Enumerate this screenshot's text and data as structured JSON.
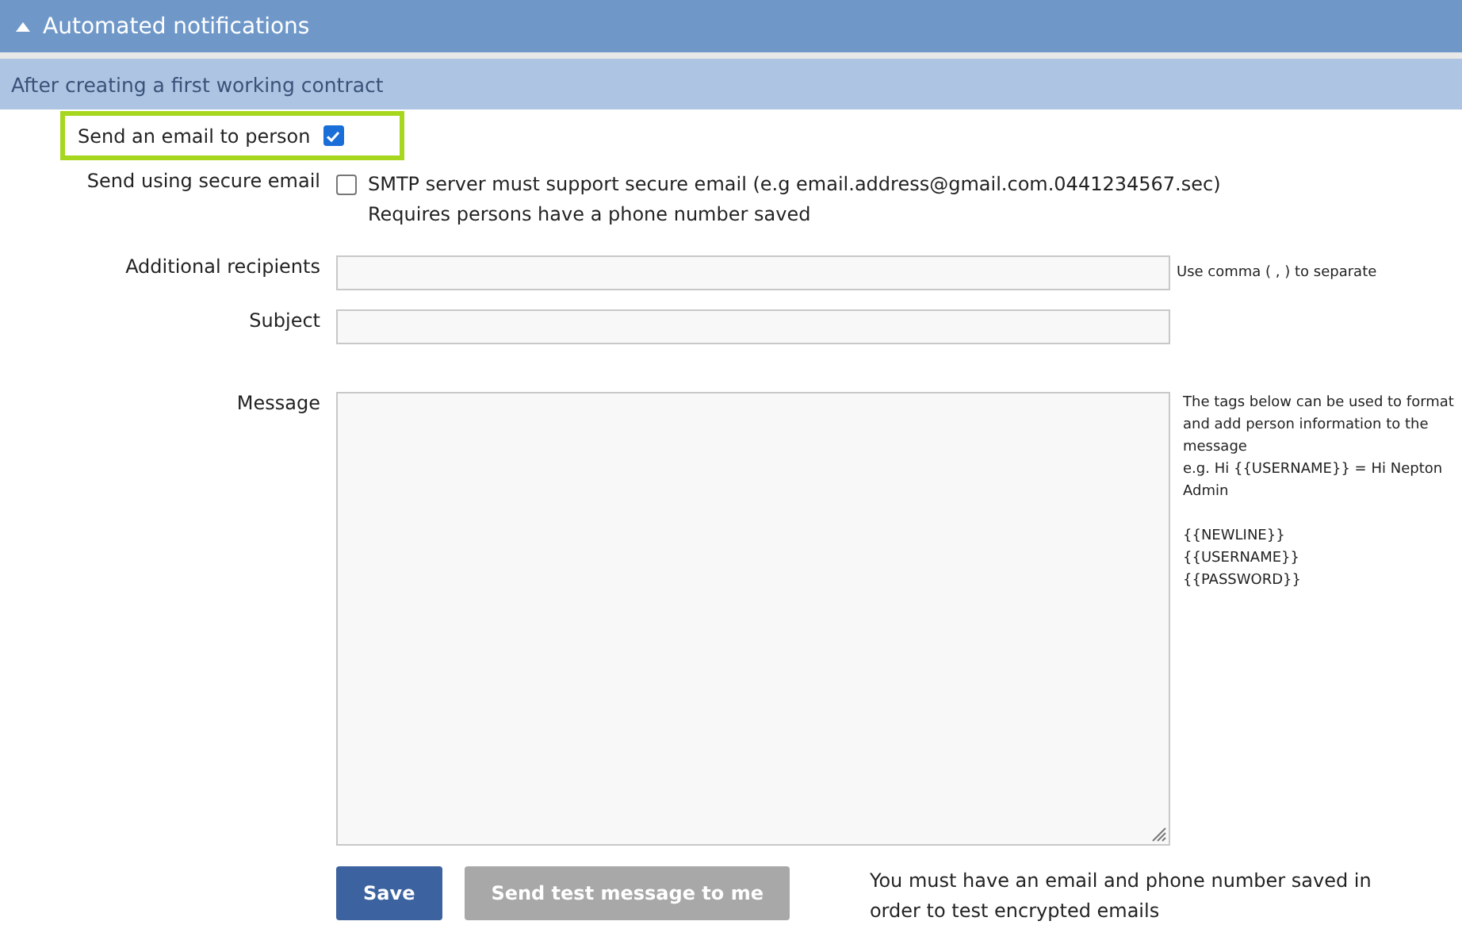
{
  "section": {
    "title": "Automated notifications",
    "expanded": true
  },
  "subsection": {
    "title": "After creating a first working contract"
  },
  "send_email": {
    "label": "Send an email to person",
    "checked": true
  },
  "secure_email": {
    "label": "Send using secure email",
    "checked": false,
    "lines": [
      "SMTP server must support secure email (e.g email.address@gmail.com.0441234567.sec)",
      "Requires persons have a phone number saved"
    ]
  },
  "recipients": {
    "label": "Additional recipients",
    "hint": "Use comma ( , ) to separate"
  },
  "subject": {
    "label": "Subject"
  },
  "message": {
    "label": "Message",
    "help": "The tags below can be used to format and add person information to the message",
    "example": "e.g. Hi {{USERNAME}} = Hi Nepton Admin",
    "tags": [
      "{{NEWLINE}}",
      "{{USERNAME}}",
      "{{PASSWORD}}"
    ]
  },
  "buttons": [
    {
      "label": "Save",
      "disabled": false
    },
    {
      "label": "Send test message to me",
      "disabled": true
    }
  ],
  "note": "You must have an email and phone number saved in order to test encrypted emails"
}
